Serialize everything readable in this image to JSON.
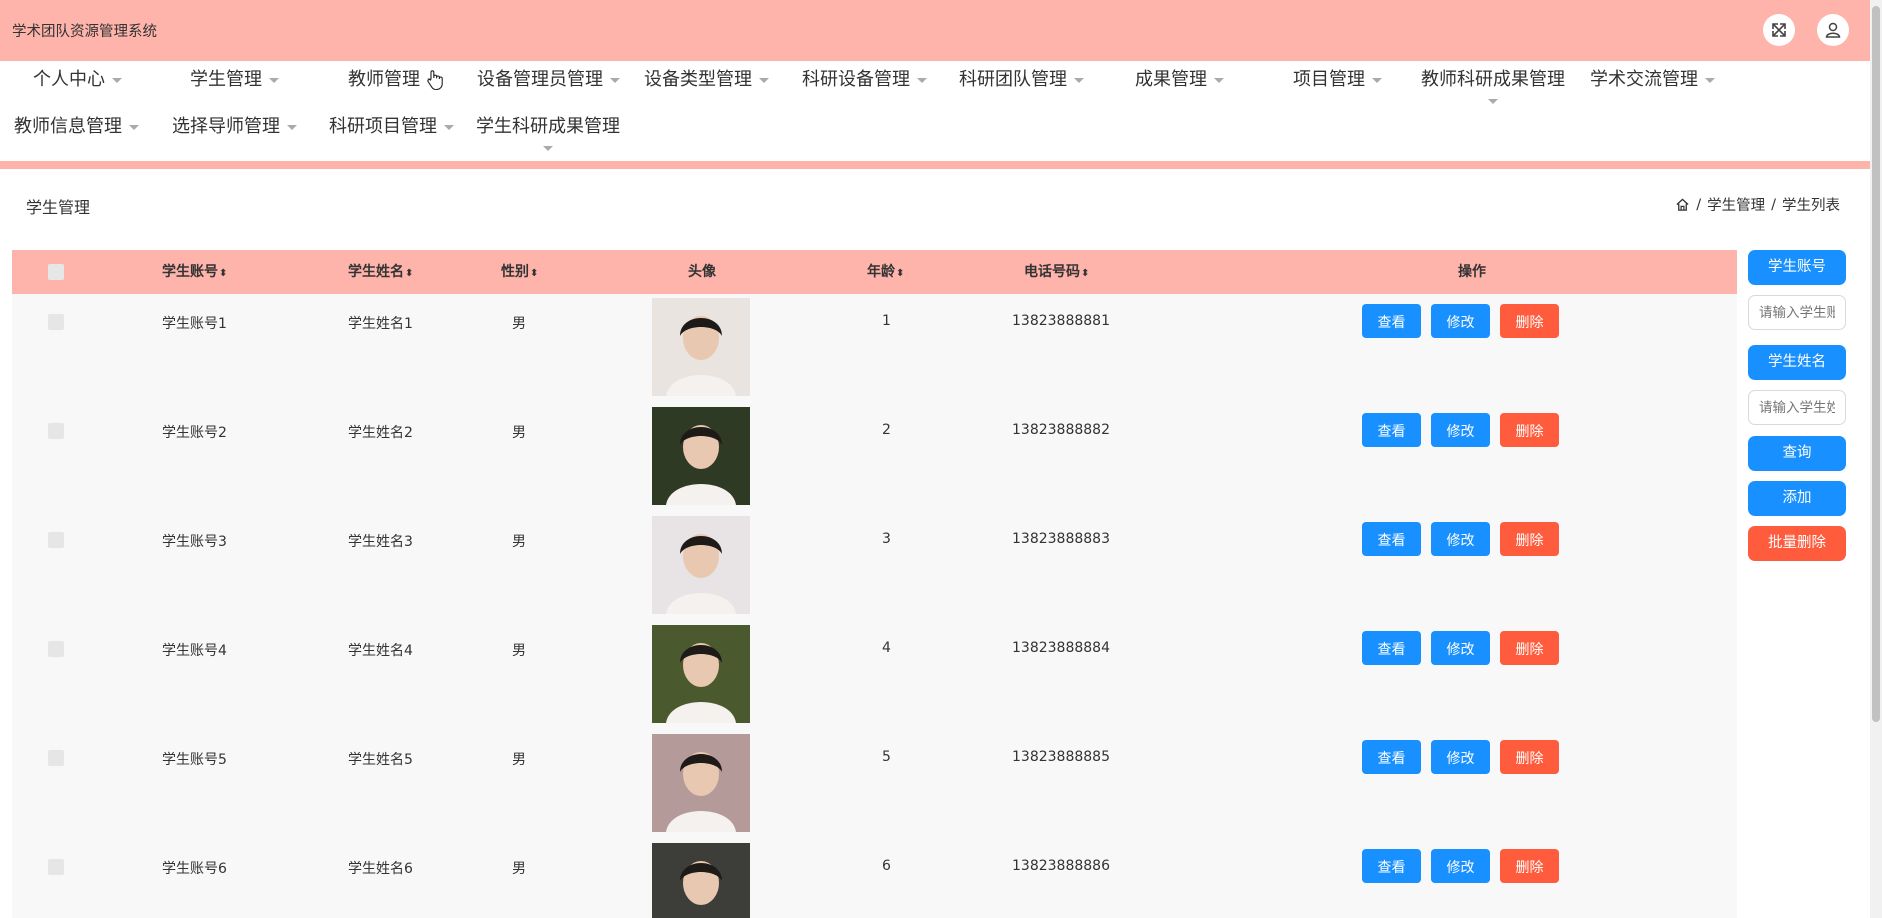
{
  "app": {
    "title": "学术团队资源管理系统"
  },
  "header_icons": [
    "fullscreen-icon",
    "user-icon"
  ],
  "nav": {
    "row1": [
      {
        "label": "个人中心"
      },
      {
        "label": "学生管理"
      },
      {
        "label": "教师管理"
      },
      {
        "label": "设备管理员管理"
      },
      {
        "label": "设备类型管理"
      },
      {
        "label": "科研设备管理"
      },
      {
        "label": "科研团队管理"
      },
      {
        "label": "成果管理"
      },
      {
        "label": "项目管理"
      },
      {
        "label": "教师科研成果管理"
      },
      {
        "label": "学术交流管理"
      }
    ],
    "row2": [
      {
        "label": "教师信息管理"
      },
      {
        "label": "选择导师管理"
      },
      {
        "label": "科研项目管理"
      },
      {
        "label": "学生科研成果管理"
      }
    ]
  },
  "page": {
    "title": "学生管理",
    "breadcrumb": [
      "学生管理",
      "学生列表"
    ],
    "separator": "/"
  },
  "table": {
    "headers": {
      "account": "学生账号",
      "name": "学生姓名",
      "gender": "性别",
      "avatar": "头像",
      "age": "年龄",
      "phone": "电话号码",
      "actions": "操作"
    },
    "sort_glyph": "⬍",
    "rows": [
      {
        "account": "学生账号1",
        "name": "学生姓名1",
        "gender": "男",
        "age": "1",
        "phone": "13823888881"
      },
      {
        "account": "学生账号2",
        "name": "学生姓名2",
        "gender": "男",
        "age": "2",
        "phone": "13823888882"
      },
      {
        "account": "学生账号3",
        "name": "学生姓名3",
        "gender": "男",
        "age": "3",
        "phone": "13823888883"
      },
      {
        "account": "学生账号4",
        "name": "学生姓名4",
        "gender": "男",
        "age": "4",
        "phone": "13823888884"
      },
      {
        "account": "学生账号5",
        "name": "学生姓名5",
        "gender": "男",
        "age": "5",
        "phone": "13823888885"
      },
      {
        "account": "学生账号6",
        "name": "学生姓名6",
        "gender": "男",
        "age": "6",
        "phone": "13823888886"
      }
    ],
    "actions": {
      "view": "查看",
      "edit": "修改",
      "delete": "删除"
    }
  },
  "search": {
    "account_label": "学生账号",
    "account_placeholder": "请输入学生账号",
    "name_label": "学生姓名",
    "name_placeholder": "请输入学生姓名",
    "query": "查询",
    "add": "添加",
    "batch_delete": "批量删除"
  },
  "colors": {
    "header_bg": "#feb4ab",
    "primary": "#1890ff",
    "danger": "#ff5b3d"
  }
}
